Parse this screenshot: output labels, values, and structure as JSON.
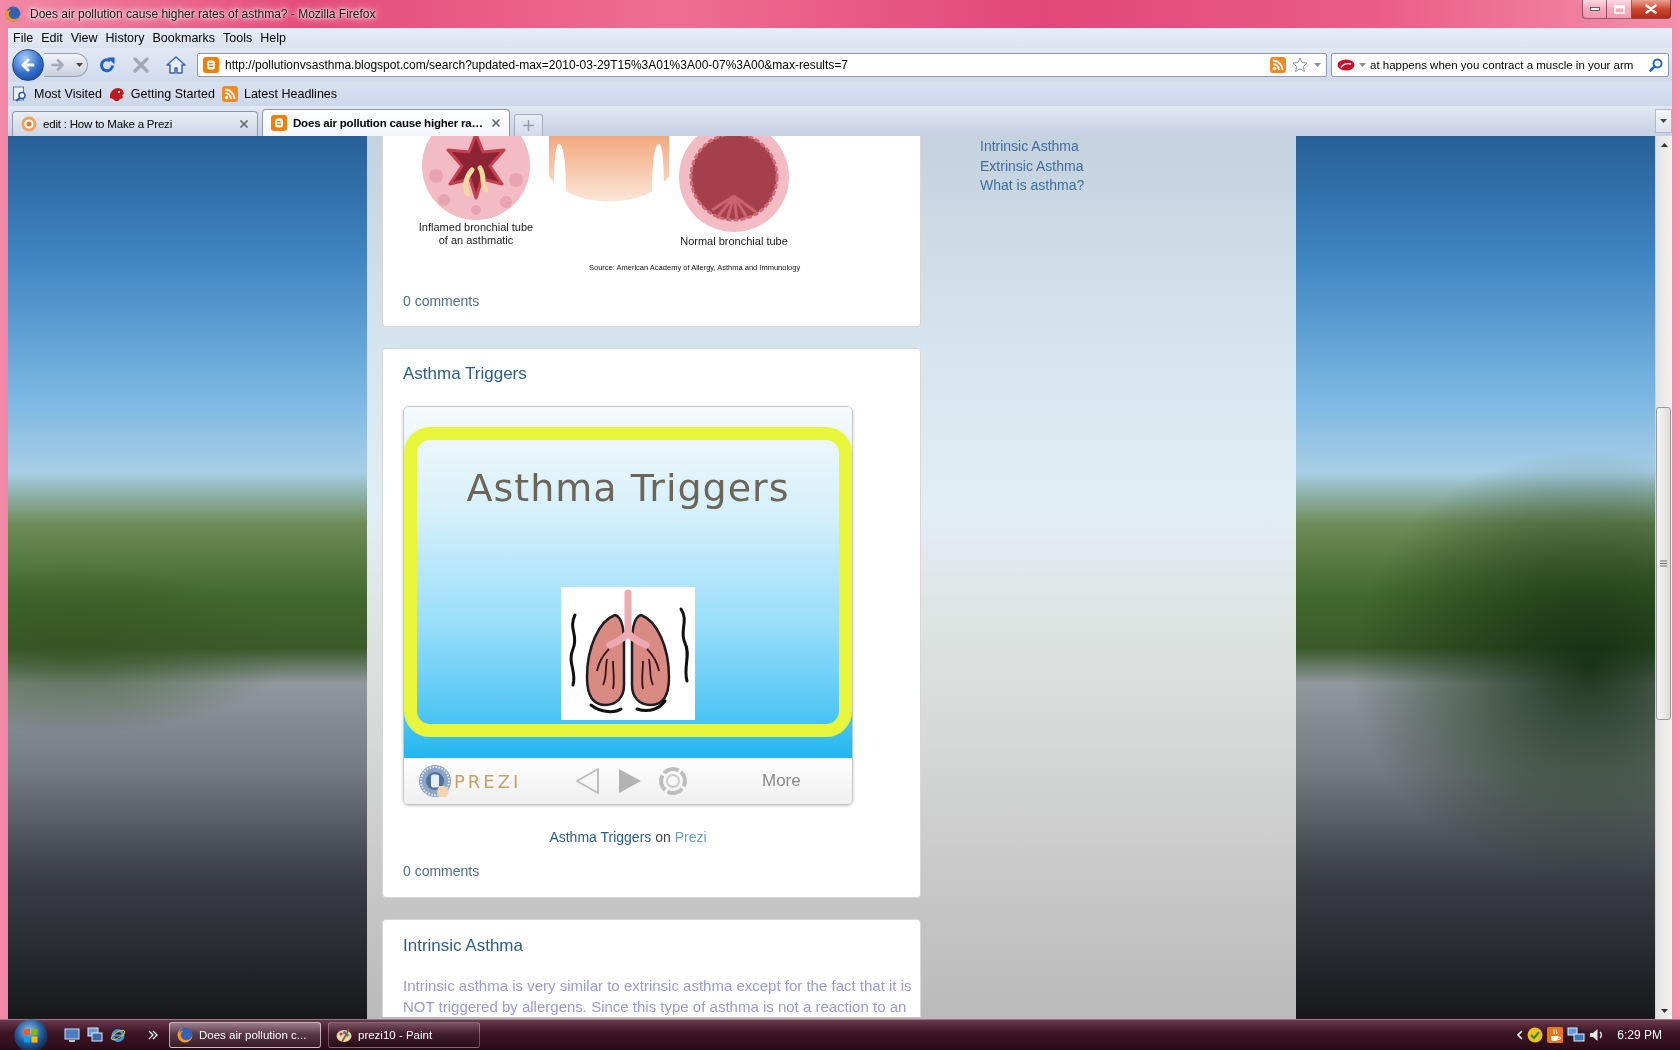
{
  "window": {
    "title": "Does air pollution cause higher rates of asthma? - Mozilla Firefox"
  },
  "menu": [
    "File",
    "Edit",
    "View",
    "History",
    "Bookmarks",
    "Tools",
    "Help"
  ],
  "nav_buttons": [
    {
      "kind": "back",
      "disabled": false
    },
    {
      "kind": "forward",
      "disabled": true
    },
    {
      "kind": "reload",
      "disabled": false
    },
    {
      "kind": "stop",
      "disabled": true
    },
    {
      "kind": "home",
      "disabled": false
    }
  ],
  "address": "http://pollutionvsasthma.blogspot.com/search?updated-max=2010-03-29T15%3A01%3A00-07%3A00&max-results=7",
  "search": {
    "value": "at happens when you contract a muscle in your arm"
  },
  "bookmarks": [
    {
      "kind": "places",
      "label": "Most Visited"
    },
    {
      "kind": "page",
      "label": "Getting Started"
    },
    {
      "kind": "feed",
      "label": "Latest Headlines"
    }
  ],
  "tabs": [
    {
      "kind": "prezi",
      "label": "edit : How to Make a Prezi",
      "selected": false
    },
    {
      "kind": "blog",
      "label": "Does air pollution cause higher ra…",
      "selected": true
    }
  ],
  "page": {
    "posts": [
      {
        "kind": "figure",
        "captions": [
          "Inflamed bronchial tube of an asthmatic",
          "Normal bronchial tube"
        ],
        "source": "Source: American Academy of Allergy, Asthma and Immunology",
        "comments": "0 comments"
      },
      {
        "kind": "prezi",
        "title": "Asthma Triggers",
        "slide_title": "Asthma Triggers",
        "logo": "PREZI",
        "more": "More",
        "caption": {
          "title_link": "Asthma Triggers",
          "joiner": "on",
          "site_link": "Prezi"
        },
        "comments": "0 comments"
      },
      {
        "kind": "text",
        "title": "Intrinsic Asthma",
        "body": "Intrinsic asthma is very similar to extrinsic asthma except for the fact that it is NOT triggered by allergens. Since this type of asthma is not a reaction to an"
      }
    ],
    "sidebar_links": [
      "Intrinsic Asthma",
      "Extrinsic Asthma",
      "What is asthma?"
    ]
  },
  "taskbar": {
    "windows": [
      {
        "kind": "firefox",
        "label": "Does air pollution c...",
        "selected": true
      },
      {
        "kind": "paint",
        "label": "prezi10 - Paint",
        "selected": false
      }
    ],
    "clock": "6:29 PM"
  }
}
